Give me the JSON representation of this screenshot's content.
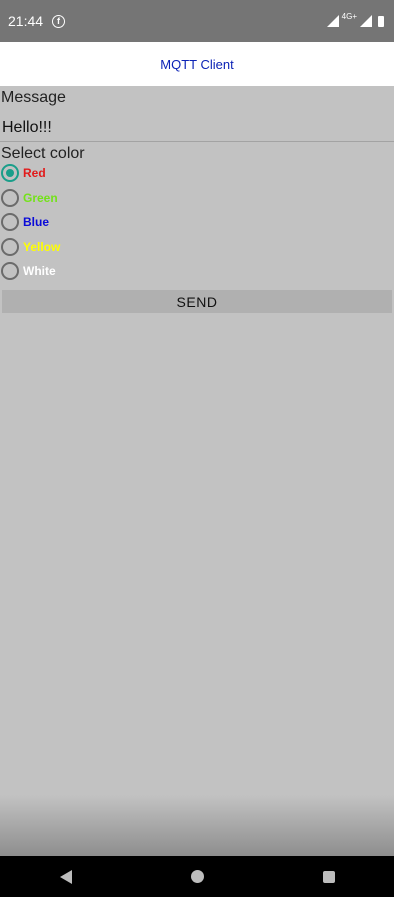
{
  "status_bar": {
    "time": "21:44",
    "facebook_glyph": "f",
    "network": "4G+"
  },
  "app": {
    "title": "MQTT Client",
    "title_color": "#0c23b6"
  },
  "message": {
    "label": "Message",
    "value": "Hello!!!"
  },
  "color_picker": {
    "label": "Select color",
    "options": [
      {
        "label": "Red",
        "color": "#e21a1a",
        "checked": true
      },
      {
        "label": "Green",
        "color": "#74e21a",
        "checked": false
      },
      {
        "label": "Blue",
        "color": "#0a0ad8",
        "checked": false
      },
      {
        "label": "Yellow",
        "color": "#ffff00",
        "checked": false
      },
      {
        "label": "White",
        "color": "#ffffff",
        "checked": false
      }
    ]
  },
  "send_button": {
    "label": "SEND"
  },
  "nav": {
    "back": "back-icon",
    "home": "home-icon",
    "recents": "recents-icon"
  }
}
